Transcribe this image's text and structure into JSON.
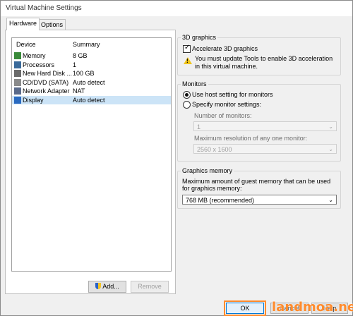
{
  "window": {
    "title": "Virtual Machine Settings"
  },
  "tabs": [
    {
      "label": "Hardware"
    },
    {
      "label": "Options"
    }
  ],
  "devices": {
    "header": {
      "device": "Device",
      "summary": "Summary"
    },
    "rows": [
      {
        "device": "Memory",
        "summary": "8 GB",
        "icon": "memory-icon",
        "color": "#3a8a3a"
      },
      {
        "device": "Processors",
        "summary": "1",
        "icon": "processor-icon",
        "color": "#3a6a9a"
      },
      {
        "device": "New Hard Disk ...",
        "summary": "100 GB",
        "icon": "hard-disk-icon",
        "color": "#6a6a6a"
      },
      {
        "device": "CD/DVD (SATA)",
        "summary": "Auto detect",
        "icon": "cd-dvd-icon",
        "color": "#8a8a8a"
      },
      {
        "device": "Network Adapter",
        "summary": "NAT",
        "icon": "network-adapter-icon",
        "color": "#5a6a8a"
      },
      {
        "device": "Display",
        "summary": "Auto detect",
        "icon": "display-icon",
        "color": "#2a6ac0",
        "selected": true
      }
    ]
  },
  "buttons": {
    "add": "Add...",
    "remove": "Remove",
    "ok": "OK",
    "cancel": "Cancel",
    "help": "Help"
  },
  "graphics3d": {
    "title": "3D graphics",
    "accelerate_label": "Accelerate 3D graphics",
    "accelerate_checked": true,
    "warning": "You must update Tools to enable 3D acceleration in this virtual machine."
  },
  "monitors": {
    "title": "Monitors",
    "use_host_label": "Use host setting for monitors",
    "specify_label": "Specify monitor settings:",
    "number_label": "Number of monitors:",
    "number_value": "1",
    "max_res_label": "Maximum resolution of any one monitor:",
    "max_res_value": "2560 x 1600"
  },
  "graphics_memory": {
    "title": "Graphics memory",
    "description": "Maximum amount of guest memory that can be used for graphics memory:",
    "value": "768 MB (recommended)"
  },
  "watermark": "landmoa.net"
}
